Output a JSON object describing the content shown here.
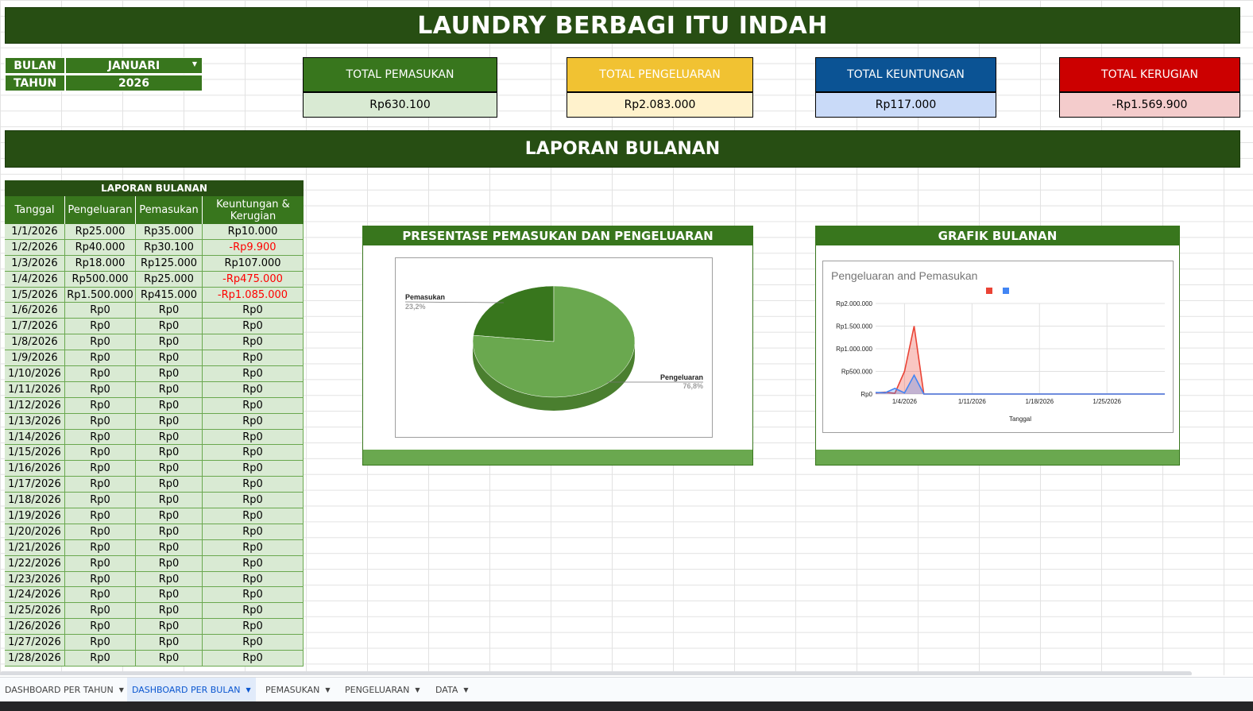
{
  "title": "LAUNDRY BERBAGI ITU INDAH",
  "selectors": {
    "bulan_label": "BULAN",
    "bulan_value": "JANUARI",
    "tahun_label": "TAHUN",
    "tahun_value": "2026"
  },
  "kpis": [
    {
      "label": "TOTAL PEMASUKAN",
      "value": "Rp630.100",
      "head_color": "#38761d",
      "val_bg": "#d9ead3"
    },
    {
      "label": "TOTAL PENGELUARAN",
      "value": "Rp2.083.000",
      "head_color": "#f1c232",
      "val_bg": "#fff2cc"
    },
    {
      "label": "TOTAL KEUNTUNGAN",
      "value": "Rp117.000",
      "head_color": "#0b5394",
      "val_bg": "#c9daf8"
    },
    {
      "label": "TOTAL KERUGIAN",
      "value": "-Rp1.569.900",
      "head_color": "#cc0000",
      "val_bg": "#f4cccc"
    }
  ],
  "section_title": "LAPORAN BULANAN",
  "table": {
    "title": "LAPORAN BULANAN",
    "headers": [
      "Tanggal",
      "Pengeluaran",
      "Pemasukan",
      "Keuntungan & Kerugian"
    ],
    "rows": [
      [
        "1/1/2026",
        "Rp25.000",
        "Rp35.000",
        "Rp10.000"
      ],
      [
        "1/2/2026",
        "Rp40.000",
        "Rp30.100",
        "-Rp9.900"
      ],
      [
        "1/3/2026",
        "Rp18.000",
        "Rp125.000",
        "Rp107.000"
      ],
      [
        "1/4/2026",
        "Rp500.000",
        "Rp25.000",
        "-Rp475.000"
      ],
      [
        "1/5/2026",
        "Rp1.500.000",
        "Rp415.000",
        "-Rp1.085.000"
      ],
      [
        "1/6/2026",
        "Rp0",
        "Rp0",
        "Rp0"
      ],
      [
        "1/7/2026",
        "Rp0",
        "Rp0",
        "Rp0"
      ],
      [
        "1/8/2026",
        "Rp0",
        "Rp0",
        "Rp0"
      ],
      [
        "1/9/2026",
        "Rp0",
        "Rp0",
        "Rp0"
      ],
      [
        "1/10/2026",
        "Rp0",
        "Rp0",
        "Rp0"
      ],
      [
        "1/11/2026",
        "Rp0",
        "Rp0",
        "Rp0"
      ],
      [
        "1/12/2026",
        "Rp0",
        "Rp0",
        "Rp0"
      ],
      [
        "1/13/2026",
        "Rp0",
        "Rp0",
        "Rp0"
      ],
      [
        "1/14/2026",
        "Rp0",
        "Rp0",
        "Rp0"
      ],
      [
        "1/15/2026",
        "Rp0",
        "Rp0",
        "Rp0"
      ],
      [
        "1/16/2026",
        "Rp0",
        "Rp0",
        "Rp0"
      ],
      [
        "1/17/2026",
        "Rp0",
        "Rp0",
        "Rp0"
      ],
      [
        "1/18/2026",
        "Rp0",
        "Rp0",
        "Rp0"
      ],
      [
        "1/19/2026",
        "Rp0",
        "Rp0",
        "Rp0"
      ],
      [
        "1/20/2026",
        "Rp0",
        "Rp0",
        "Rp0"
      ],
      [
        "1/21/2026",
        "Rp0",
        "Rp0",
        "Rp0"
      ],
      [
        "1/22/2026",
        "Rp0",
        "Rp0",
        "Rp0"
      ],
      [
        "1/23/2026",
        "Rp0",
        "Rp0",
        "Rp0"
      ],
      [
        "1/24/2026",
        "Rp0",
        "Rp0",
        "Rp0"
      ],
      [
        "1/25/2026",
        "Rp0",
        "Rp0",
        "Rp0"
      ],
      [
        "1/26/2026",
        "Rp0",
        "Rp0",
        "Rp0"
      ],
      [
        "1/27/2026",
        "Rp0",
        "Rp0",
        "Rp0"
      ],
      [
        "1/28/2026",
        "Rp0",
        "Rp0",
        "Rp0"
      ]
    ]
  },
  "pie_panel_title": "PRESENTASE PEMASUKAN DAN PENGELUARAN",
  "line_panel_title": "GRAFIK BULANAN",
  "tabs": [
    {
      "label": "DASHBOARD PER TAHUN",
      "active": false
    },
    {
      "label": "DASHBOARD PER BULAN",
      "active": true
    },
    {
      "label": "PEMASUKAN",
      "active": false
    },
    {
      "label": "PENGELUARAN",
      "active": false
    },
    {
      "label": "DATA",
      "active": false
    }
  ],
  "chart_data": [
    {
      "type": "pie",
      "slices": [
        {
          "label": "Pemasukan",
          "value": 23.2,
          "pct_label": "23,2%",
          "color": "#38761d"
        },
        {
          "label": "Pengeluaran",
          "value": 76.8,
          "pct_label": "76,8%",
          "color": "#6aa84f"
        }
      ]
    },
    {
      "type": "area",
      "title": "Pengeluaran and Pemasukan",
      "xlabel": "Tanggal",
      "ylabel": "",
      "x": [
        "1/1/2026",
        "1/2/2026",
        "1/3/2026",
        "1/4/2026",
        "1/5/2026",
        "1/6/2026",
        "1/7/2026",
        "1/8/2026",
        "1/9/2026",
        "1/10/2026",
        "1/11/2026",
        "1/12/2026",
        "1/13/2026",
        "1/14/2026",
        "1/15/2026",
        "1/16/2026",
        "1/17/2026",
        "1/18/2026",
        "1/19/2026",
        "1/20/2026",
        "1/21/2026",
        "1/22/2026",
        "1/23/2026",
        "1/24/2026",
        "1/25/2026",
        "1/26/2026",
        "1/27/2026",
        "1/28/2026",
        "1/29/2026",
        "1/30/2026",
        "1/31/2026"
      ],
      "x_ticks": [
        "1/4/2026",
        "1/11/2026",
        "1/18/2026",
        "1/25/2026"
      ],
      "y_ticks": [
        "Rp0",
        "Rp500.000",
        "Rp1.000.000",
        "Rp1.500.000",
        "Rp2.000.000"
      ],
      "ylim": [
        0,
        2000000
      ],
      "series": [
        {
          "color": "#ea4335",
          "values": [
            25000,
            40000,
            18000,
            500000,
            1500000,
            0,
            0,
            0,
            0,
            0,
            0,
            0,
            0,
            0,
            0,
            0,
            0,
            0,
            0,
            0,
            0,
            0,
            0,
            0,
            0,
            0,
            0,
            0,
            0,
            0,
            0
          ]
        },
        {
          "color": "#4285f4",
          "values": [
            35000,
            30100,
            125000,
            25000,
            415000,
            0,
            0,
            0,
            0,
            0,
            0,
            0,
            0,
            0,
            0,
            0,
            0,
            0,
            0,
            0,
            0,
            0,
            0,
            0,
            0,
            0,
            0,
            0,
            0,
            0,
            0
          ]
        }
      ],
      "legend": "top",
      "grid": true
    }
  ]
}
